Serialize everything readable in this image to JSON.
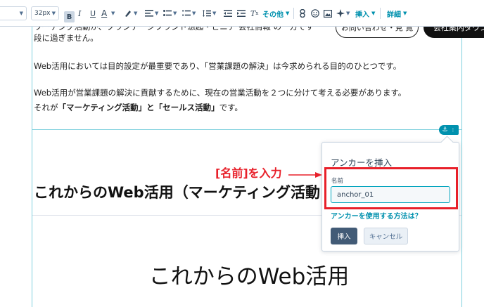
{
  "toolbar": {
    "font_size": "32px",
    "bold": "B",
    "italic": "I",
    "underline": "U",
    "text_color": "A",
    "more_label": "その他",
    "insert_label": "挿入",
    "advanced_label": "詳細"
  },
  "content": {
    "top_partial_line": "ワーテング活動が、ブランデ一ジブランド想起・ビニア   会社情報   の一方です",
    "intro_line_end": "段に過ぎません。",
    "para1": "Web活用においては目的設定が最重要であり、「営業課題の解決」は今求められる目的のひとつです。",
    "para2": "Web活用が営業課題の解決に貢献するために、現在の営業活動を２つに分けて考える必要があります。",
    "para3_prefix": "それが",
    "para3_bold": "「マーケティング活動」と「セールス活動」",
    "para3_suffix": "です。",
    "cta_outline_label": "お問い合わせ・見   覧",
    "cta_dark_label": "会社案内ダウンロード",
    "heading": "これからのWeb活用（マーケティング活動",
    "big_heading": "これからのWeb活用"
  },
  "anchor_popover": {
    "title": "アンカーを挿入",
    "name_label": "名前",
    "name_value": "anchor_01",
    "help_link": "アンカーを使用する方法は？",
    "insert_button": "挿入",
    "cancel_button": "キャンセル"
  },
  "annotation": {
    "text": "[名前]を入力",
    "color": "#e8202a"
  },
  "colors": {
    "accent": "#0091ae",
    "input_border": "#00a4bd",
    "primary_button": "#425b76"
  }
}
